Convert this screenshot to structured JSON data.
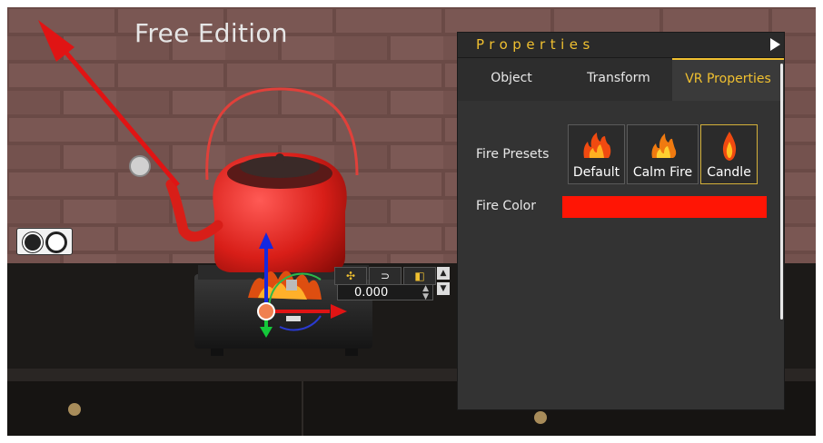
{
  "viewport": {
    "edition_label": "Free Edition",
    "view_toggle_icon": "stereo-view-icon",
    "gizmo": {
      "toolbar_icons": [
        "move-icon",
        "rotate-icon",
        "scale-icon"
      ],
      "numeric_value": "0.000"
    }
  },
  "properties_panel": {
    "title": "Properties",
    "tabs": [
      {
        "label": "Object",
        "active": false
      },
      {
        "label": "Transform",
        "active": false
      },
      {
        "label": "VR Properties",
        "active": true
      }
    ],
    "fire_presets": {
      "label": "Fire Presets",
      "options": [
        {
          "label": "Default",
          "icon": "fire-icon",
          "selected": false
        },
        {
          "label": "Calm Fire",
          "icon": "fire-icon",
          "selected": false
        },
        {
          "label": "Candle",
          "icon": "candle-flame-icon",
          "selected": true
        }
      ]
    },
    "fire_color": {
      "label": "Fire Color",
      "value": "#ff1505"
    }
  },
  "colors": {
    "accent": "#f0c030",
    "panel_bg": "#333333",
    "kettle": "#e0211c"
  }
}
